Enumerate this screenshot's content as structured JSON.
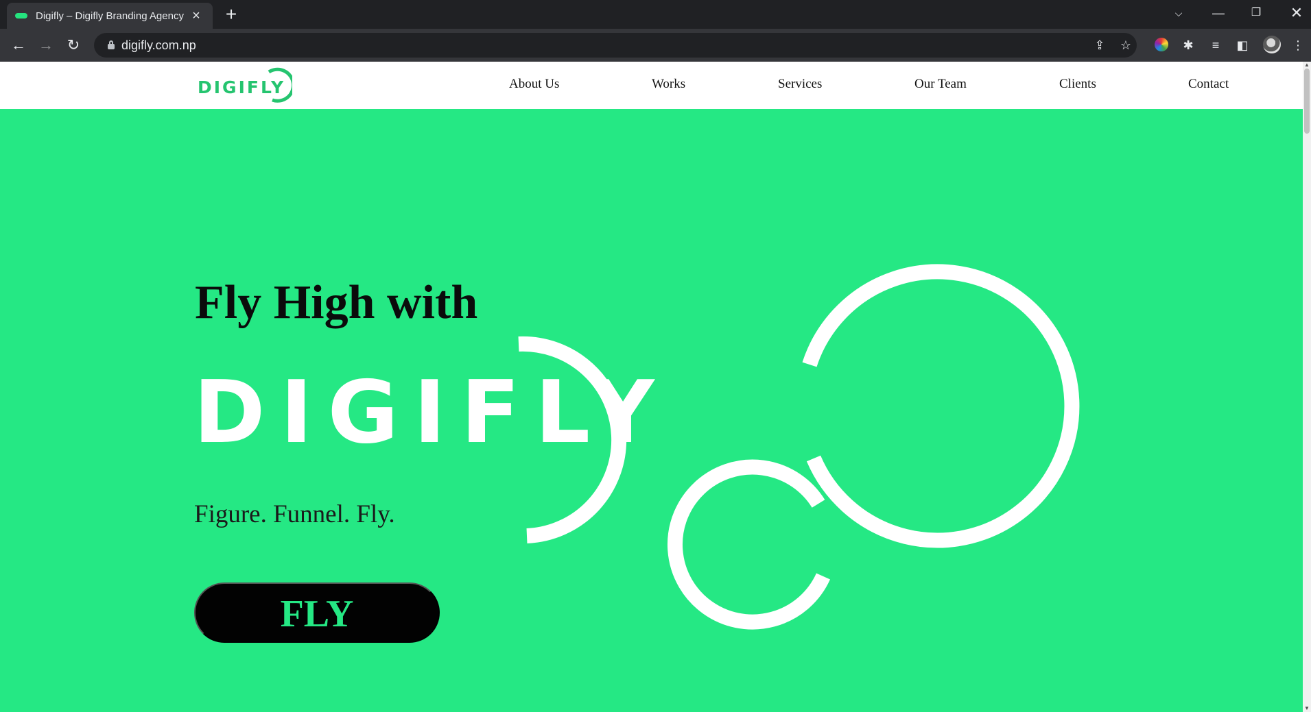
{
  "browser": {
    "tab_title": "Digifly – Digifly Branding Agency",
    "url": "digifly.com.np"
  },
  "site": {
    "logo_text": "DIGIFLY",
    "nav": [
      "About Us",
      "Works",
      "Services",
      "Our Team",
      "Clients",
      "Contact"
    ]
  },
  "hero": {
    "heading": "Fly High with",
    "brand": "DIGIFLY",
    "tagline": "Figure. Funnel. Fly.",
    "cta": "FLY"
  },
  "colors": {
    "brand_green": "#25e884",
    "logo_green": "#25c46f",
    "button_bg": "#020202"
  }
}
